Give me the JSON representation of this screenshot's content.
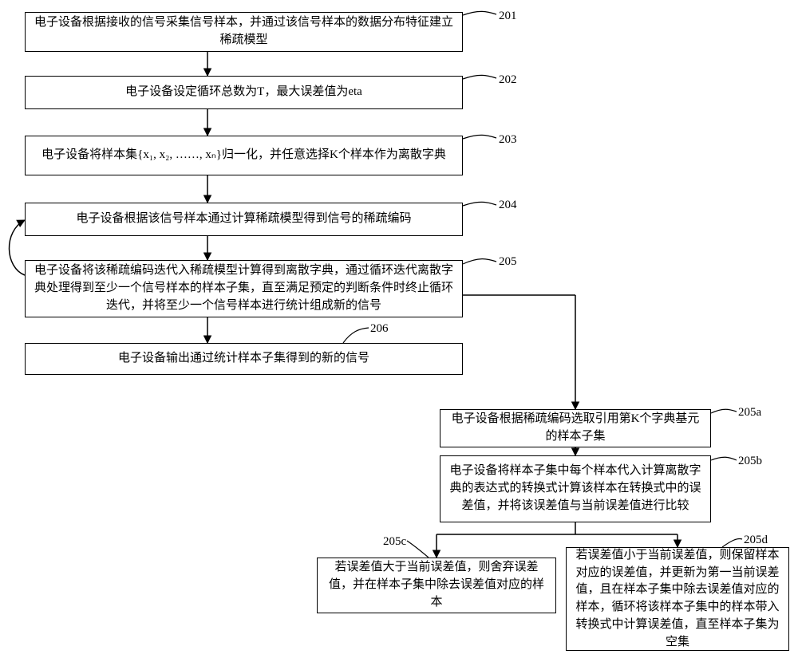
{
  "steps": {
    "s201": {
      "label": "201",
      "text": "电子设备根据接收的信号采集信号样本，并通过该信号样本的数据分布特征建立稀疏模型"
    },
    "s202": {
      "label": "202",
      "text": "电子设备设定循环总数为T，最大误差值为eta"
    },
    "s203": {
      "label": "203",
      "text": "电子设备将样本集{x₁, x₂, ……, xₙ}归一化，并任意选择K个样本作为离散字典"
    },
    "s204": {
      "label": "204",
      "text": "电子设备根据该信号样本通过计算稀疏模型得到信号的稀疏编码"
    },
    "s205": {
      "label": "205",
      "text": "电子设备将该稀疏编码迭代入稀疏模型计算得到离散字典，通过循环迭代离散字典处理得到至少一个信号样本的样本子集，直至满足预定的判断条件时终止循环迭代，并将至少一个信号样本进行统计组成新的信号"
    },
    "s206": {
      "label": "206",
      "text": "电子设备输出通过统计样本子集得到的新的信号"
    },
    "s205a": {
      "label": "205a",
      "text": "电子设备根据稀疏编码选取引用第K个字典基元的样本子集"
    },
    "s205b": {
      "label": "205b",
      "text": "电子设备将样本子集中每个样本代入计算离散字典的表达式的转换式计算该样本在转换式中的误差值，并将该误差值与当前误差值进行比较"
    },
    "s205c": {
      "label": "205c",
      "text": "若误差值大于当前误差值，则舍弃误差值，并在样本子集中除去误差值对应的样本"
    },
    "s205d": {
      "label": "205d",
      "text": "若误差值小于当前误差值，则保留样本对应的误差值，并更新为第一当前误差值，且在样本子集中除去误差值对应的样本，循环将该样本子集中的样本带入转换式中计算误差值，直至样本子集为空集"
    }
  }
}
